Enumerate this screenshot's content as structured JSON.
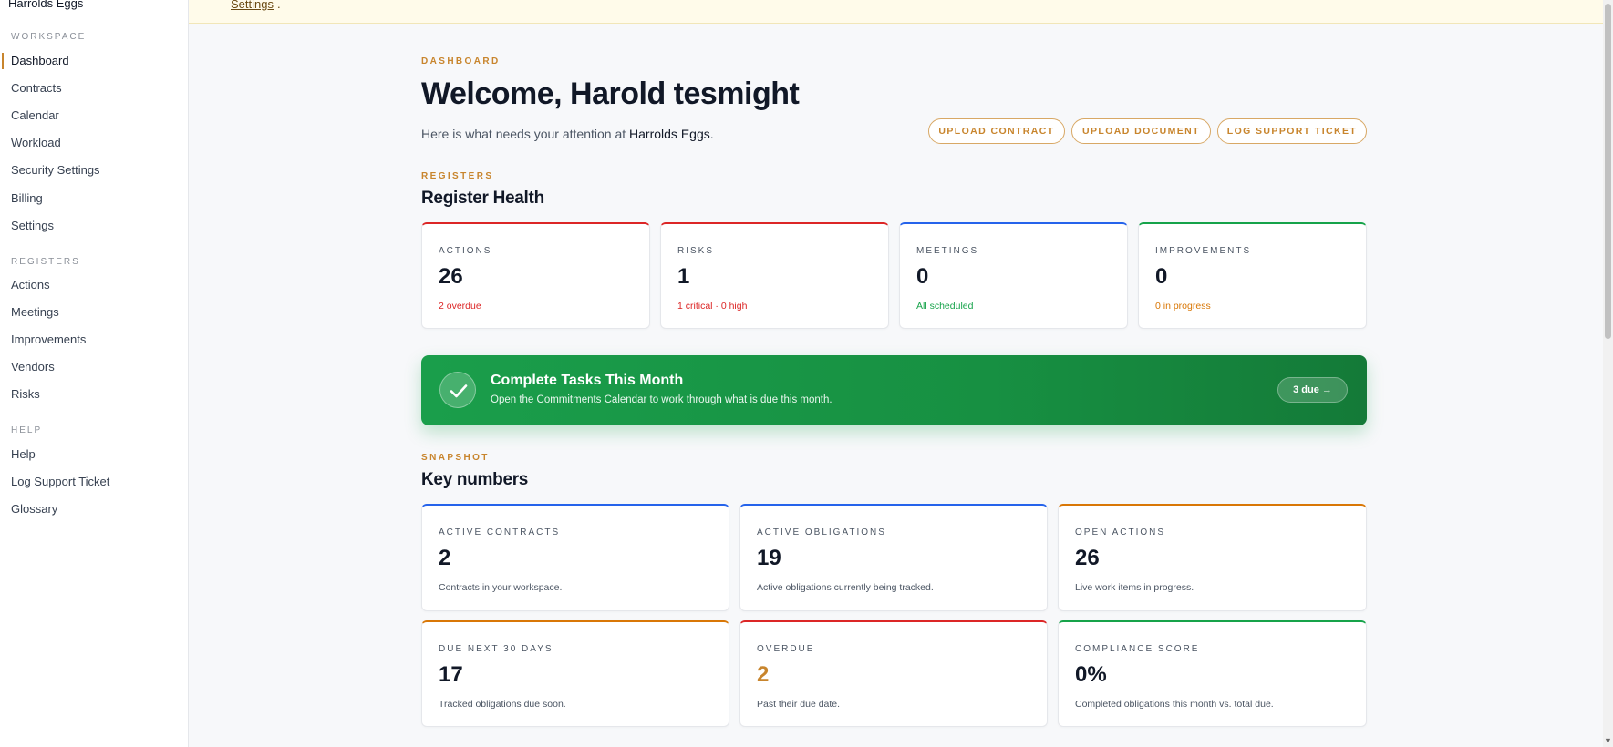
{
  "sidebar": {
    "brand": "Harrolds Eggs",
    "sections": {
      "workspace": "WORKSPACE",
      "registers": "REGISTERS",
      "help": "HELP"
    },
    "workspace_items": [
      "Dashboard",
      "Contracts",
      "Calendar",
      "Workload",
      "Security Settings",
      "Billing",
      "Settings"
    ],
    "register_items": [
      "Actions",
      "Meetings",
      "Improvements",
      "Vendors",
      "Risks"
    ],
    "help_items": [
      "Help",
      "Log Support Ticket",
      "Glossary"
    ]
  },
  "banner": {
    "link": "Settings",
    "tail": "."
  },
  "header": {
    "eyebrow": "DASHBOARD",
    "title": "Welcome, Harold tesmight",
    "subtitle_prefix": "Here is what needs your attention at ",
    "company": "Harrolds Eggs",
    "subtitle_suffix": ".",
    "buttons": [
      "UPLOAD CONTRACT",
      "UPLOAD DOCUMENT",
      "LOG SUPPORT TICKET"
    ]
  },
  "registers": {
    "eyebrow": "REGISTERS",
    "title": "Register Health",
    "cards": [
      {
        "label": "ACTIONS",
        "value": "26",
        "sub": "2 overdue",
        "accent": "#dc2626",
        "sub_color": "#dc2626"
      },
      {
        "label": "RISKS",
        "value": "1",
        "sub": "1 critical · 0 high",
        "accent": "#dc2626",
        "sub_color": "#dc2626"
      },
      {
        "label": "MEETINGS",
        "value": "0",
        "sub": "All scheduled",
        "accent": "#2563eb",
        "sub_color": "#16a34a"
      },
      {
        "label": "IMPROVEMENTS",
        "value": "0",
        "sub": "0 in progress",
        "accent": "#16a34a",
        "sub_color": "#d97706"
      }
    ]
  },
  "promo": {
    "title": "Complete Tasks This Month",
    "desc": "Open the Commitments Calendar to work through what is due this month.",
    "pill": "3  due  →",
    "icon": "check-icon",
    "color": "#179042"
  },
  "snapshot": {
    "eyebrow": "SNAPSHOT",
    "title": "Key numbers",
    "cards": [
      {
        "label": "ACTIVE CONTRACTS",
        "value": "2",
        "desc": "Contracts in your workspace.",
        "accent": "#2563eb"
      },
      {
        "label": "ACTIVE OBLIGATIONS",
        "value": "19",
        "desc": "Active obligations currently being tracked.",
        "accent": "#2563eb"
      },
      {
        "label": "OPEN ACTIONS",
        "value": "26",
        "desc": "Live work items in progress.",
        "accent": "#d97706"
      },
      {
        "label": "DUE NEXT 30 DAYS",
        "value": "17",
        "desc": "Tracked obligations due soon.",
        "accent": "#d97706"
      },
      {
        "label": "OVERDUE",
        "value": "2",
        "desc": "Past their due date.",
        "accent": "#dc2626",
        "value_color": "#c8852d"
      },
      {
        "label": "COMPLIANCE SCORE",
        "value": "0%",
        "desc": "Completed obligations this month vs. total due.",
        "accent": "#16a34a"
      }
    ]
  },
  "colors": {
    "accent": "#c8852d",
    "red": "#dc2626",
    "blue": "#2563eb",
    "green": "#16a34a",
    "orange": "#d97706"
  }
}
